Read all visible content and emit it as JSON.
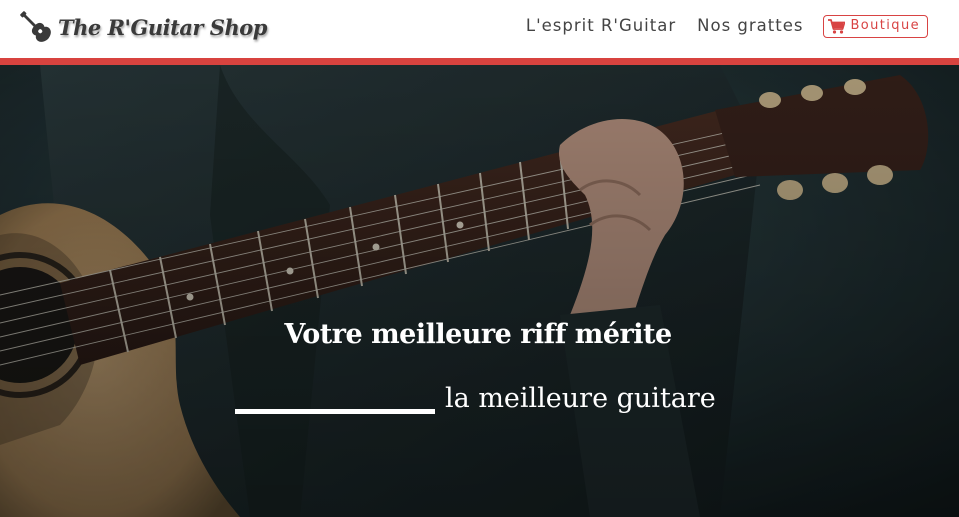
{
  "header": {
    "logo_text": "The R'Guitar Shop",
    "logo_icon": "guitar-icon",
    "nav": [
      {
        "label": "L'esprit R'Guitar"
      },
      {
        "label": "Nos grattes"
      }
    ],
    "shop_button": {
      "label": "Boutique",
      "icon": "cart-icon"
    }
  },
  "hero": {
    "title": "Votre meilleure riff mérite",
    "subtitle": "la meilleure guitare"
  },
  "colors": {
    "accent": "#d8433f",
    "header_text": "#444444",
    "hero_text": "#ffffff"
  }
}
